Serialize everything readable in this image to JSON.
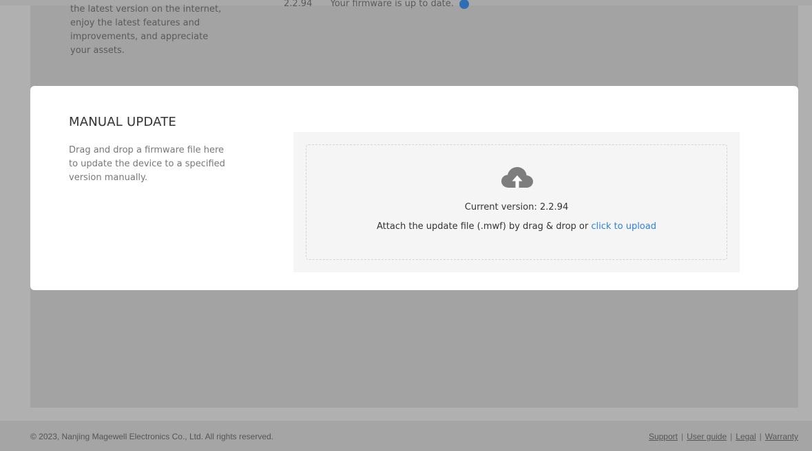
{
  "online_update": {
    "description": "the latest version on the internet, enjoy the latest features and improvements, and appreciate your assets.",
    "version": "2.2.94",
    "status_text": "Your firmware is up to date."
  },
  "manual_update": {
    "title": "MANUAL UPDATE",
    "description": "Drag and drop a firmware file here to update the device to a specified version manually.",
    "icon": "cloud-upload-icon",
    "current_version": "Current version: 2.2.94",
    "attach_text": "Attach the update file (.mwf) by drag & drop or ",
    "upload_link": "click to upload"
  },
  "footer": {
    "copyright": "© 2023, Nanjing Magewell Electronics Co., Ltd. All rights reserved.",
    "links": [
      "Support",
      "User guide",
      "Legal",
      "Warranty"
    ]
  },
  "colors": {
    "overlay": "#b0b0b0",
    "link": "#2f80d4",
    "status_icon": "#2f6eb5"
  }
}
